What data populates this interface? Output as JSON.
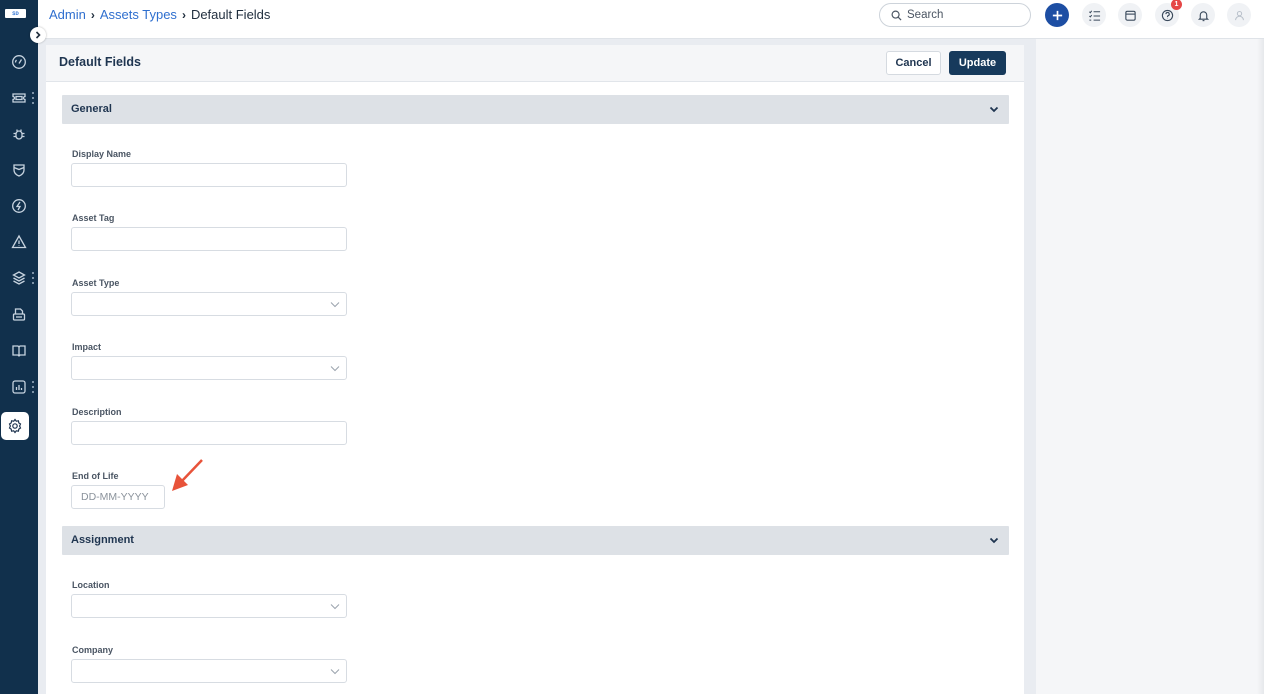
{
  "sidebar": {
    "logo_text": "ꜱᴅ",
    "items": [
      {
        "name": "dashboard",
        "icon": "gauge-icon",
        "has_menu": false
      },
      {
        "name": "tickets",
        "icon": "ticket-icon",
        "has_menu": true
      },
      {
        "name": "problems",
        "icon": "bug-icon",
        "has_menu": false
      },
      {
        "name": "changes",
        "icon": "shield-icon",
        "has_menu": false
      },
      {
        "name": "releases",
        "icon": "lightning-icon",
        "has_menu": false
      },
      {
        "name": "alerts",
        "icon": "warning-icon",
        "has_menu": false
      },
      {
        "name": "assets",
        "icon": "layers-icon",
        "has_menu": true
      },
      {
        "name": "purchase",
        "icon": "printer-icon",
        "has_menu": false
      },
      {
        "name": "knowledge",
        "icon": "book-icon",
        "has_menu": false
      },
      {
        "name": "reports",
        "icon": "chart-icon",
        "has_menu": true
      },
      {
        "name": "admin",
        "icon": "gear-icon",
        "has_menu": false,
        "active": true
      }
    ]
  },
  "header": {
    "breadcrumb": [
      {
        "label": "Admin",
        "link": true
      },
      {
        "label": "Assets Types",
        "link": true
      },
      {
        "label": "Default Fields",
        "link": false
      }
    ],
    "search_placeholder": "Search",
    "help_badge": "1",
    "accent_color": "#1d4ea3"
  },
  "card": {
    "title": "Default Fields",
    "cancel_label": "Cancel",
    "update_label": "Update"
  },
  "sections": {
    "general": {
      "title": "General",
      "fields": [
        {
          "label": "Display Name",
          "type": "text",
          "value": ""
        },
        {
          "label": "Asset Tag",
          "type": "text",
          "value": ""
        },
        {
          "label": "Asset Type",
          "type": "select",
          "value": ""
        },
        {
          "label": "Impact",
          "type": "select",
          "value": ""
        },
        {
          "label": "Description",
          "type": "text",
          "value": ""
        },
        {
          "label": "End of Life",
          "type": "date",
          "value": "",
          "placeholder": "DD-MM-YYYY"
        }
      ]
    },
    "assignment": {
      "title": "Assignment",
      "fields": [
        {
          "label": "Location",
          "type": "select",
          "value": ""
        },
        {
          "label": "Company",
          "type": "select",
          "value": ""
        }
      ]
    }
  },
  "annotation": {
    "arrow_color": "#e8533a"
  }
}
